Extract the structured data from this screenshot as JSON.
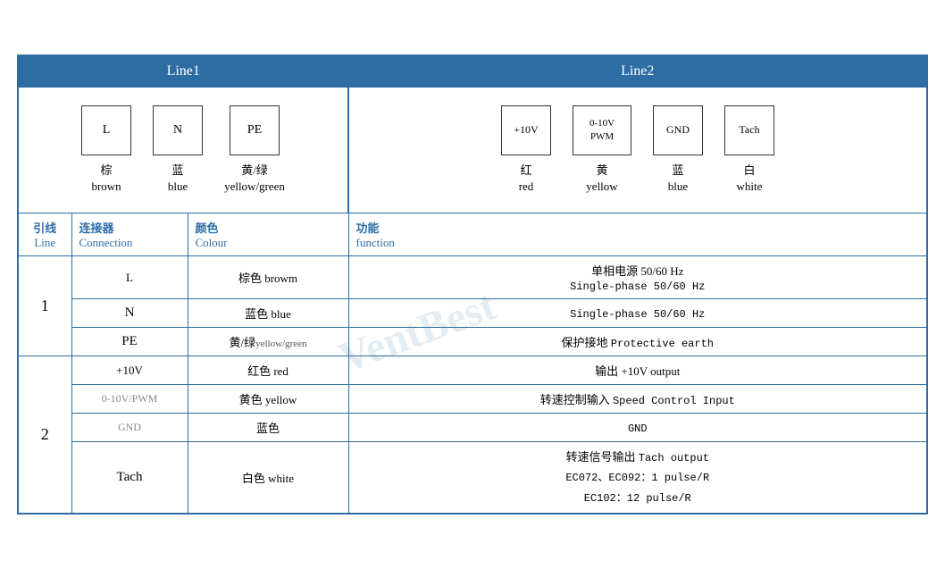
{
  "headers": {
    "line1": "Line1",
    "line2": "Line2"
  },
  "line1_connectors": [
    {
      "label": "L",
      "zh": "棕",
      "en": "brown"
    },
    {
      "label": "N",
      "zh": "蓝",
      "en": "blue"
    },
    {
      "label": "PE",
      "zh": "黄/绿",
      "en": "yellow/green"
    }
  ],
  "line2_connectors": [
    {
      "label": "+10V",
      "zh": "红",
      "en": "red"
    },
    {
      "label": "0-10V\nPWM",
      "zh": "黄",
      "en": "yellow"
    },
    {
      "label": "GND",
      "zh": "蓝",
      "en": "blue"
    },
    {
      "label": "Tach",
      "zh": "白",
      "en": "white"
    }
  ],
  "table_headers": {
    "line": {
      "zh": "引线",
      "en": "Line"
    },
    "connection": {
      "zh": "连接器",
      "en": "Connection"
    },
    "colour": {
      "zh": "颜色",
      "en": "Colour"
    },
    "function": {
      "zh": "功能",
      "en": "function"
    }
  },
  "rows": [
    {
      "line": "1",
      "rowspan": 3,
      "entries": [
        {
          "connection": "L",
          "colour_zh": "棕色",
          "colour_en": "browm",
          "function": "单相电源 50/60 Hz\nSingle-phase 50/60 Hz",
          "function_multi": false
        },
        {
          "connection": "N",
          "colour_zh": "蓝色",
          "colour_en": "blue",
          "function": "Single-phase 50/60 Hz",
          "function_multi": false
        },
        {
          "connection": "PE",
          "colour_zh": "黄/绿",
          "colour_en_small": "yellow/green",
          "function": "保护接地 Protective earth",
          "function_multi": false
        }
      ]
    },
    {
      "line": "2",
      "rowspan": 4,
      "entries": [
        {
          "connection": "+10V",
          "colour_zh": "红色",
          "colour_en": "red",
          "function": "输出 +10V output",
          "function_multi": false
        },
        {
          "connection": "0-10V/PWM",
          "colour_zh": "黄色",
          "colour_en": "yellow",
          "function": "转速控制输入 Speed Control Input",
          "function_multi": false
        },
        {
          "connection": "GND",
          "colour_zh": "蓝色",
          "colour_en": "",
          "function": "GND",
          "function_multi": false
        },
        {
          "connection": "Tach",
          "colour_zh": "白色",
          "colour_en": "white",
          "function": "转速信号输出 Tach output\nEC072、EC092：1 pulse/R\nEC102：12 pulse/R",
          "function_multi": true
        }
      ]
    }
  ]
}
